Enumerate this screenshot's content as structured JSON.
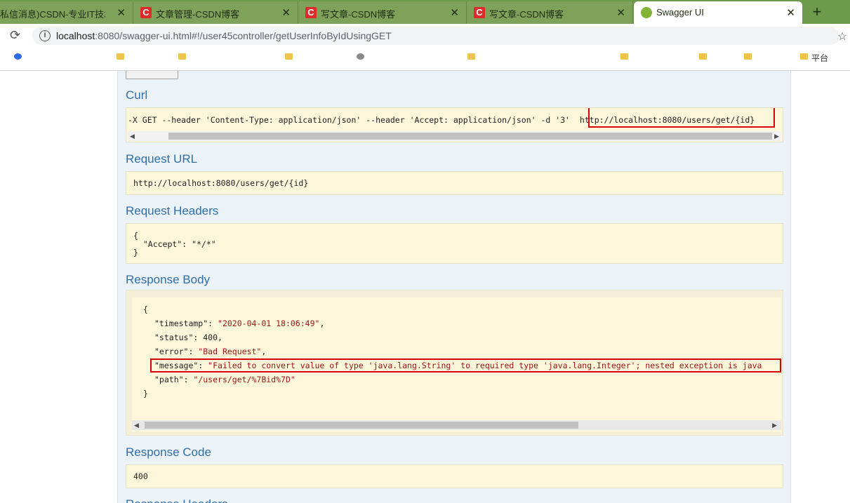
{
  "browser": {
    "tabs": [
      {
        "title": "私信消息)CSDN-专业IT技术社区",
        "close": "✕"
      },
      {
        "title": "文章管理-CSDN博客",
        "close": "✕",
        "favicon": "C"
      },
      {
        "title": "写文章-CSDN博客",
        "close": "✕",
        "favicon": "C"
      },
      {
        "title": "写文章-CSDN博客",
        "close": "✕",
        "favicon": "C"
      },
      {
        "title": "Swagger UI",
        "close": "✕",
        "active": true
      }
    ],
    "new_tab": "+",
    "reload_icon": "⟳",
    "info_icon": "i",
    "url_host": "localhost",
    "url_rest": ":8080/swagger-ui.html#!/user45controller/getUserInfoByIdUsingGET",
    "bookmark_star": "☆",
    "bookmarks": [
      "",
      "",
      "",
      "",
      "",
      "",
      "",
      "",
      "",
      "",
      "",
      "",
      "平台"
    ]
  },
  "swagger": {
    "curl": {
      "heading": "Curl",
      "command": "-X GET --header 'Content-Type: application/json' --header 'Accept: application/json' -d '3' ",
      "url": "http://localhost:8080/users/get/{id}"
    },
    "request_url": {
      "heading": "Request URL",
      "value": "http://localhost:8080/users/get/{id}"
    },
    "request_headers": {
      "heading": "Request Headers",
      "line1": "{",
      "line2": "  \"Accept\": \"*/*\"",
      "line3": "}"
    },
    "response_body": {
      "heading": "Response Body",
      "open": "{",
      "timestamp_key": "\"timestamp\"",
      "timestamp_val": "\"2020-04-01 18:06:49\"",
      "status_key": "\"status\"",
      "status_val": "400",
      "error_key": "\"error\"",
      "error_val": "\"Bad Request\"",
      "message_key": "\"message\"",
      "message_val": "\"Failed to convert value of type 'java.lang.String' to required type 'java.lang.Integer'; nested exception is java",
      "path_key": "\"path\"",
      "path_val": "\"/users/get/%7Bid%7D\"",
      "close": "}"
    },
    "response_code": {
      "heading": "Response Code",
      "value": "400"
    },
    "response_headers": {
      "heading": "Response Headers"
    }
  },
  "colors": {
    "tab_strip": "#6e9a4b",
    "heading_blue": "#2f6ea8",
    "code_bg": "#fcf6db",
    "highlight_red": "#d80000"
  }
}
